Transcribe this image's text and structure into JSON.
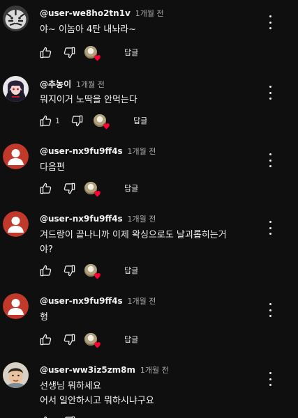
{
  "ui": {
    "reply_label": "답글",
    "colors": {
      "background": "#0f0f0f",
      "heart": "#ff0033",
      "default_avatar": "#c0392b"
    }
  },
  "comments": [
    {
      "author": "@user-we8ho2tn1v",
      "time": "1개월 전",
      "lines": [
        "야~ 이놈아 4탄 내놔라~"
      ],
      "likes": "",
      "avatar": "tiger"
    },
    {
      "author": "@추농이",
      "time": "1개월 전",
      "lines": [
        "뭐지이거 노딱을 안먹는다"
      ],
      "likes": "1",
      "avatar": "anime-character"
    },
    {
      "author": "@user-nx9fu9ff4s",
      "time": "1개월 전",
      "lines": [
        "다음편"
      ],
      "likes": "",
      "avatar": "default"
    },
    {
      "author": "@user-nx9fu9ff4s",
      "time": "1개월 전",
      "lines": [
        "겨드랑이 끝나니까 이제 왁싱으로도 날괴롭히는거",
        "야?"
      ],
      "likes": "",
      "avatar": "default"
    },
    {
      "author": "@user-nx9fu9ff4s",
      "time": "1개월 전",
      "lines": [
        "형"
      ],
      "likes": "",
      "avatar": "default"
    },
    {
      "author": "@user-ww3iz5zm8m",
      "time": "1개월 전",
      "lines": [
        "선생님 뭐하세요",
        "어서 일안하시고 뭐하시냐구요"
      ],
      "likes": "",
      "avatar": "photo"
    }
  ]
}
